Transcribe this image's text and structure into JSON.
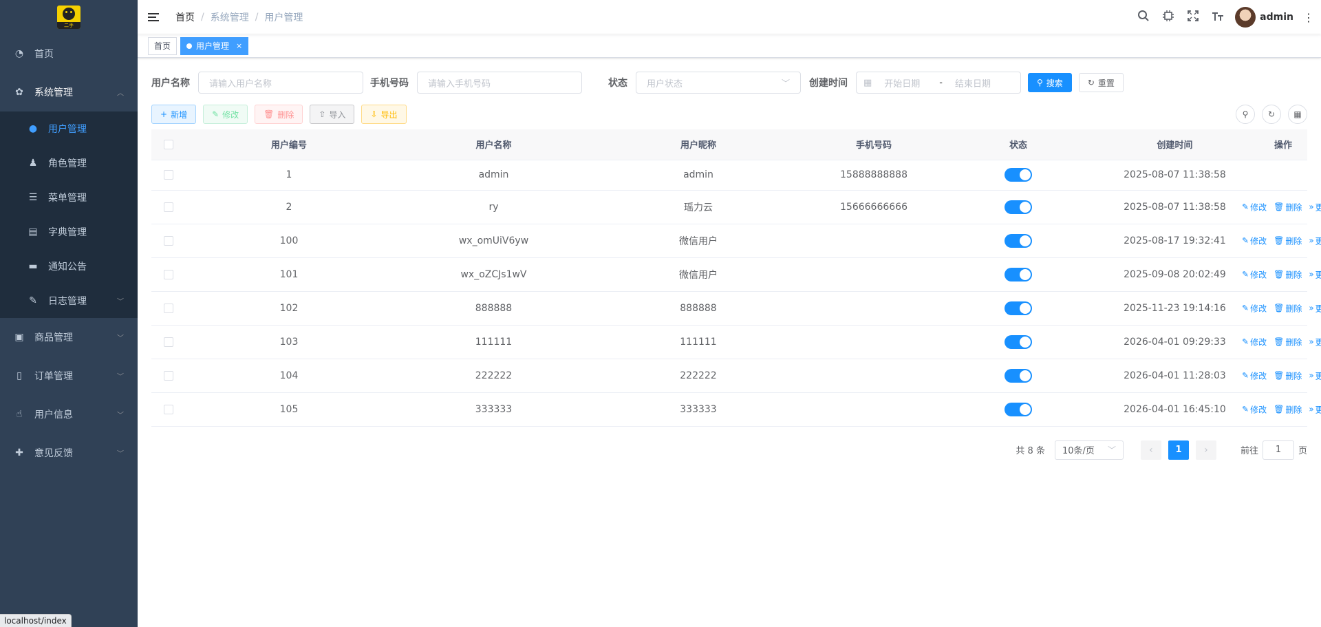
{
  "logo": {
    "text": "二手"
  },
  "sidebar": {
    "items": [
      {
        "label": "首页",
        "icon": "dashboard-icon"
      },
      {
        "label": "系统管理",
        "icon": "gear-icon"
      },
      {
        "label": "商品管理",
        "icon": "goods-icon"
      },
      {
        "label": "订单管理",
        "icon": "book-icon"
      },
      {
        "label": "用户信息",
        "icon": "thumbs-up-icon"
      },
      {
        "label": "意见反馈",
        "icon": "feedback-icon"
      }
    ],
    "sub_items": [
      {
        "label": "用户管理",
        "icon": "user-icon"
      },
      {
        "label": "角色管理",
        "icon": "peoples-icon"
      },
      {
        "label": "菜单管理",
        "icon": "tree-table-icon"
      },
      {
        "label": "字典管理",
        "icon": "dict-icon"
      },
      {
        "label": "通知公告",
        "icon": "message-icon"
      },
      {
        "label": "日志管理",
        "icon": "log-icon"
      }
    ]
  },
  "url_hint": "localhost/index",
  "breadcrumb": [
    "首页",
    "系统管理",
    "用户管理"
  ],
  "header": {
    "username": "admin"
  },
  "tags": {
    "home": "首页",
    "active": "用户管理",
    "close": "×"
  },
  "search": {
    "username_label": "用户名称",
    "username_placeholder": "请输入用户名称",
    "phone_label": "手机号码",
    "phone_placeholder": "请输入手机号码",
    "status_label": "状态",
    "status_placeholder": "用户状态",
    "time_label": "创建时间",
    "start_placeholder": "开始日期",
    "range_sep": "-",
    "end_placeholder": "结束日期",
    "search_btn": "搜索",
    "reset_btn": "重置"
  },
  "toolbar": {
    "add": "新增",
    "edit": "修改",
    "delete": "删除",
    "import": "导入",
    "export": "导出"
  },
  "table": {
    "columns": [
      "用户编号",
      "用户名称",
      "用户昵称",
      "手机号码",
      "状态",
      "创建时间",
      "操作"
    ],
    "rows": [
      {
        "id": "1",
        "name": "admin",
        "nick": "admin",
        "phone": "15888888888",
        "enabled": true,
        "created": "2025-08-07 11:38:58",
        "ops": false
      },
      {
        "id": "2",
        "name": "ry",
        "nick": "瑶力云",
        "phone": "15666666666",
        "enabled": true,
        "created": "2025-08-07 11:38:58",
        "ops": true
      },
      {
        "id": "100",
        "name": "wx_omUiV6yw",
        "nick": "微信用户",
        "phone": "",
        "enabled": true,
        "created": "2025-08-17 19:32:41",
        "ops": true
      },
      {
        "id": "101",
        "name": "wx_oZCJs1wV",
        "nick": "微信用户",
        "phone": "",
        "enabled": true,
        "created": "2025-09-08 20:02:49",
        "ops": true
      },
      {
        "id": "102",
        "name": "888888",
        "nick": "888888",
        "phone": "",
        "enabled": true,
        "created": "2025-11-23 19:14:16",
        "ops": true
      },
      {
        "id": "103",
        "name": "111111",
        "nick": "111111",
        "phone": "",
        "enabled": true,
        "created": "2026-04-01 09:29:33",
        "ops": true
      },
      {
        "id": "104",
        "name": "222222",
        "nick": "222222",
        "phone": "",
        "enabled": true,
        "created": "2026-04-01 11:28:03",
        "ops": true
      },
      {
        "id": "105",
        "name": "333333",
        "nick": "333333",
        "phone": "",
        "enabled": true,
        "created": "2026-04-01 16:45:10",
        "ops": true
      }
    ],
    "op_labels": {
      "edit": "修改",
      "delete": "删除",
      "more": "更多"
    }
  },
  "pagination": {
    "total": "共 8 条",
    "page_size": "10条/页",
    "current": "1",
    "goto_prefix": "前往",
    "goto_value": "1",
    "goto_suffix": "页"
  },
  "colors": {
    "primary": "#1890ff",
    "sidebar_bg": "#304156",
    "submenu_bg": "#1f2d3d"
  }
}
